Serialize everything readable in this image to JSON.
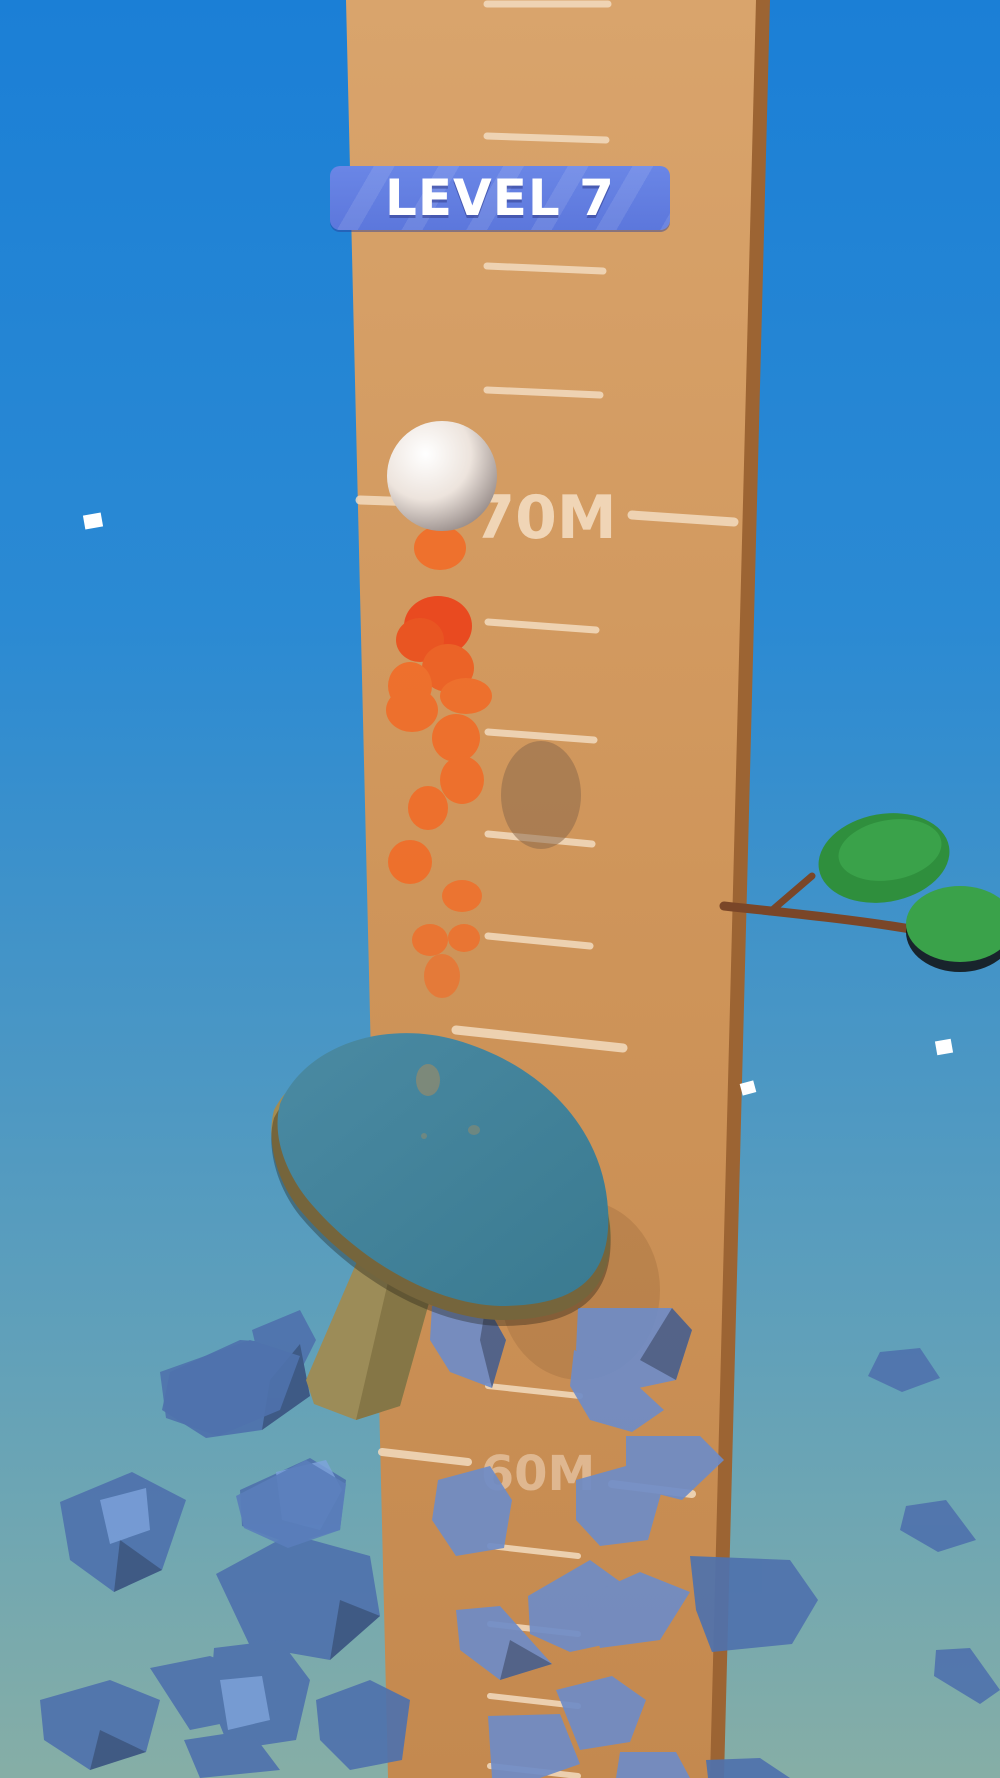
{
  "hud": {
    "level_label": "LEVEL 7"
  },
  "ruler": {
    "markers": [
      {
        "label": "70M"
      },
      {
        "label": "60M"
      }
    ]
  },
  "colors": {
    "sky_top": "#1b7fd6",
    "sky_bottom": "#86aea6",
    "tower": "#d49a60",
    "tower_side": "#a0693a",
    "badge": "#6580e2",
    "paddle_face": "#3f7f96",
    "paddle_handle": "#9a8a55",
    "ball": "#f2ebe6",
    "trail": "#f05a1e",
    "rocks": "#5b7fb8",
    "leaves": "#3aa24a"
  },
  "objects": {
    "ball_icon": "ping-pong-ball",
    "paddle_icon": "ping-pong-paddle",
    "tree_icon": "branch-with-leaves"
  }
}
